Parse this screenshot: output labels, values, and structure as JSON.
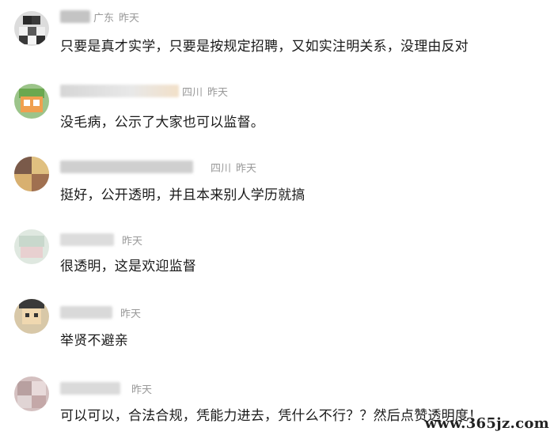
{
  "comments": [
    {
      "region": "广东",
      "time": "昨天",
      "text": "只要是真才实学，只要是按规定招聘，又如实注明关系，没理由反对",
      "avatar": "avatar"
    },
    {
      "region": "四川",
      "time": "昨天",
      "text": "没毛病，公示了大家也可以监督。",
      "avatar": "avatar"
    },
    {
      "region": "四川",
      "time": "昨天",
      "text": "挺好，公开透明，并且本来别人学历就搞",
      "avatar": "avatar"
    },
    {
      "region": "",
      "time": "昨天",
      "text": "很透明，这是欢迎监督",
      "avatar": "avatar"
    },
    {
      "region": "",
      "time": "昨天",
      "text": "举贤不避亲",
      "avatar": "avatar"
    },
    {
      "region": "",
      "time": "昨天",
      "text": "可以可以，合法合规，凭能力进去，凭什么不行？？然后点赞透明度！",
      "avatar": "avatar"
    }
  ],
  "watermark": "www.365jz.com"
}
